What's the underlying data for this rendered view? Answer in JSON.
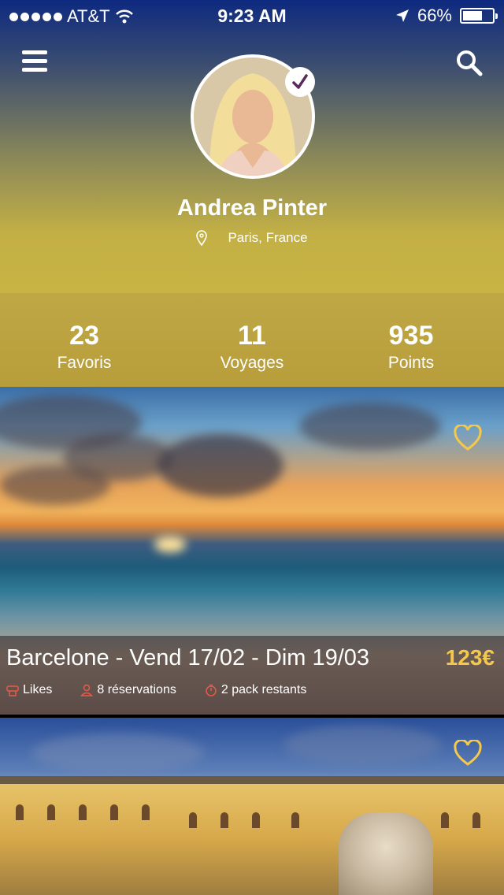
{
  "status_bar": {
    "carrier": "AT&T",
    "time": "9:23 AM",
    "battery": "66%",
    "battery_fraction": 0.66,
    "icons": [
      "signal-dots-icon",
      "wifi-icon",
      "location-arrow-icon",
      "battery-icon"
    ]
  },
  "header": {
    "menu_icon": "hamburger-menu-icon",
    "search_icon": "search-icon"
  },
  "profile": {
    "name": "Andrea Pinter",
    "location": "Paris, France",
    "verified_icon": "checkmark-icon",
    "location_icon": "map-pin-icon"
  },
  "stats": [
    {
      "value": "23",
      "label": "Favoris"
    },
    {
      "value": "11",
      "label": "Voyages"
    },
    {
      "value": "935",
      "label": "Points"
    }
  ],
  "cards": [
    {
      "title": "Barcelone - Vend 17/02 - Dim 19/03",
      "price": "123€",
      "likes_label": "Likes",
      "reservations": "8 réservations",
      "remaining": "2 pack restants",
      "heart_icon": "heart-outline-icon"
    },
    {
      "heart_icon": "heart-outline-icon"
    }
  ],
  "colors": {
    "accent_gold": "#f5c84a",
    "meta_icon": "#e85a4a",
    "header_top": "#0e2a80",
    "header_bottom": "#c8b444"
  }
}
